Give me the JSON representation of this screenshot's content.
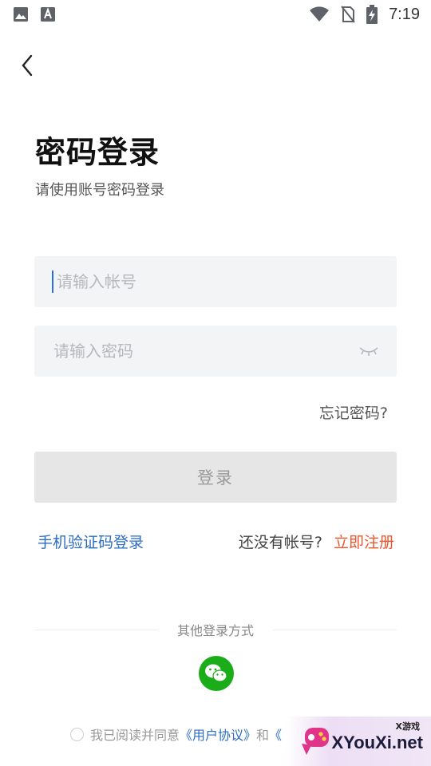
{
  "status_bar": {
    "time": "7:19",
    "icons": [
      "image-icon",
      "font-icon",
      "wifi-icon",
      "no-sim-icon",
      "battery-charging-icon"
    ]
  },
  "header": {
    "back_icon": "chevron-left-icon"
  },
  "title": "密码登录",
  "subtitle": "请使用账号密码登录",
  "account_input": {
    "placeholder": "请输入帐号",
    "value": ""
  },
  "password_input": {
    "placeholder": "请输入密码",
    "value": "",
    "toggle_icon": "eye-closed-icon"
  },
  "forgot_password": "忘记密码?",
  "login_button": "登录",
  "sms_login": "手机验证码登录",
  "no_account": "还没有帐号?",
  "register": "立即注册",
  "other_login": "其他登录方式",
  "social": {
    "icon": "wechat-icon",
    "color": "#1aad19"
  },
  "agreement": {
    "prefix": "我已阅读并同意",
    "user_agreement": "《用户协议》",
    "and": "和",
    "privacy_partial": "《"
  },
  "watermark": {
    "small": "X游戏",
    "big": "XYouXi.net"
  },
  "colors": {
    "link_blue": "#2b6cc4",
    "register_orange": "#f0552e",
    "wechat_green": "#1aad19"
  }
}
